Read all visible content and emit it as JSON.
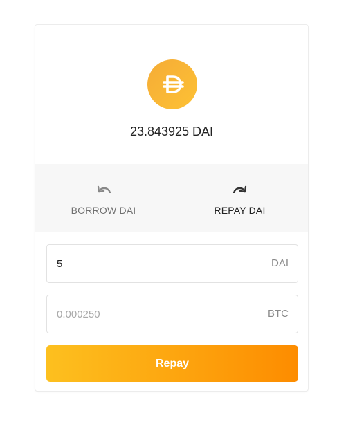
{
  "token": {
    "icon": "dai-logo-icon",
    "balance_text": "23.843925 DAI",
    "brand_color": "#f5ac37"
  },
  "tabs": [
    {
      "label": "BORROW DAI",
      "icon": "undo-icon",
      "active": false
    },
    {
      "label": "REPAY DAI",
      "icon": "redo-icon",
      "active": true
    }
  ],
  "form": {
    "amount": {
      "value": "5",
      "placeholder": "",
      "unit": "DAI"
    },
    "collateral": {
      "value": "",
      "placeholder": "0.000250",
      "unit": "BTC"
    },
    "submit_label": "Repay",
    "button_gradient": [
      "#fdc01f",
      "#fd8c00"
    ]
  }
}
